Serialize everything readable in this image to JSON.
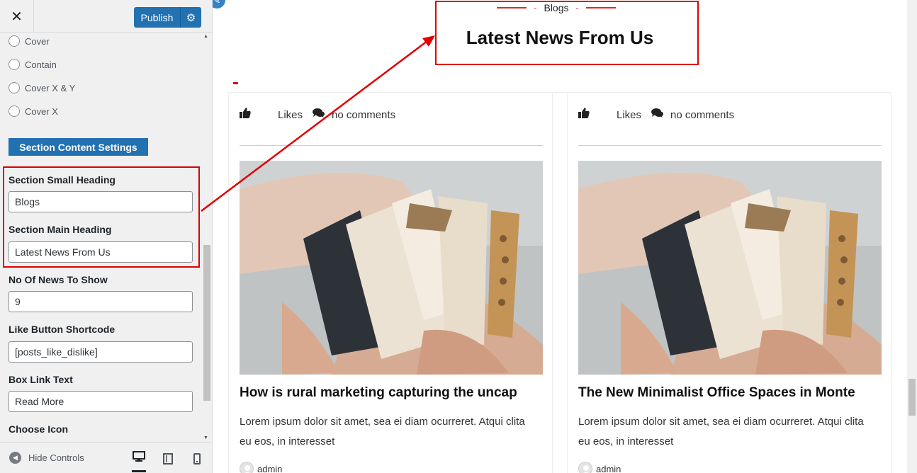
{
  "header": {
    "close_icon": "close-icon",
    "publish_label": "Publish",
    "settings_icon": "gear-icon"
  },
  "sidebar": {
    "background_size_options": [
      "Cover",
      "Contain",
      "Cover X & Y",
      "Cover X"
    ],
    "section_button": "Section Content Settings",
    "fields": {
      "small_heading": {
        "label": "Section Small Heading",
        "value": "Blogs"
      },
      "main_heading": {
        "label": "Section Main Heading",
        "value": "Latest News From Us"
      },
      "news_count": {
        "label": "No Of News To Show",
        "value": "9"
      },
      "like_shortcode": {
        "label": "Like Button Shortcode",
        "value": "[posts_like_dislike]"
      },
      "box_link_text": {
        "label": "Box Link Text",
        "value": "Read More"
      },
      "choose_icon": {
        "label": "Choose Icon"
      }
    }
  },
  "footer": {
    "hide_controls": "Hide Controls",
    "devices": [
      "desktop",
      "tablet",
      "mobile"
    ]
  },
  "preview": {
    "small_heading": "Blogs",
    "main_heading": "Latest News From Us",
    "cards": [
      {
        "likes_label": "Likes",
        "comments_label": "no comments",
        "title": "How is rural marketing capturing the uncap",
        "excerpt": "Lorem ipsum dolor sit amet, sea ei diam ocurreret. Atqui clita eu eos, in interesset",
        "author": "admin"
      },
      {
        "likes_label": "Likes",
        "comments_label": "no comments",
        "title": "The New Minimalist Office Spaces in Monte",
        "excerpt": "Lorem ipsum dolor sit amet, sea ei diam ocurreret. Atqui clita eu eos, in interesset",
        "author": "admin"
      }
    ]
  },
  "colors": {
    "primary": "#2271b1",
    "annotation": "#e00000",
    "accent_line": "#e02b20"
  }
}
